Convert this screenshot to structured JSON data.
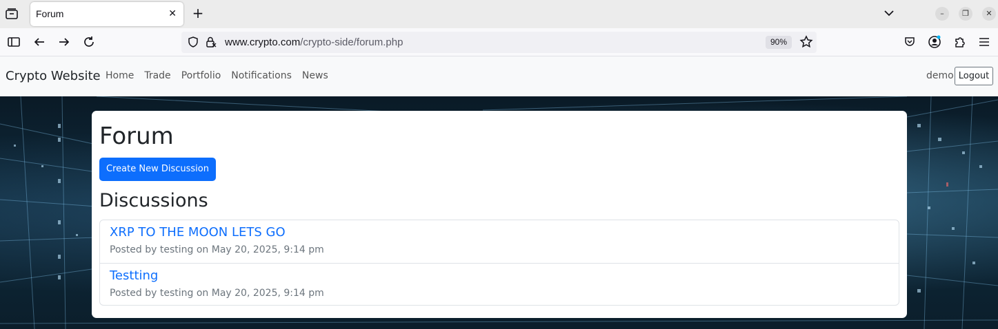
{
  "browser": {
    "tab": {
      "title": "Forum",
      "close_icon": "close-icon"
    },
    "new_tab_icon": "plus-icon",
    "url": {
      "domain": "www.crypto.com",
      "path": "/crypto-side/forum.php"
    },
    "zoom": "90%",
    "window_buttons": [
      "minimize",
      "restore",
      "close"
    ]
  },
  "site": {
    "brand": "Crypto Website",
    "nav": [
      "Home",
      "Trade",
      "Portfolio",
      "Notifications",
      "News"
    ],
    "user": "demo",
    "logout_label": "Logout"
  },
  "forum": {
    "title": "Forum",
    "create_label": "Create New Discussion",
    "section_title": "Discussions",
    "discussions": [
      {
        "title": "XRP TO THE MOON LETS GO",
        "meta": "Posted by testing on May 20, 2025, 9:14 pm"
      },
      {
        "title": "Testting",
        "meta": "Posted by testing on May 20, 2025, 9:14 pm"
      }
    ]
  },
  "colors": {
    "accent": "#0d6efd",
    "navbar_bg": "#f8f9fa",
    "text": "#212529",
    "muted": "#6c757d"
  }
}
